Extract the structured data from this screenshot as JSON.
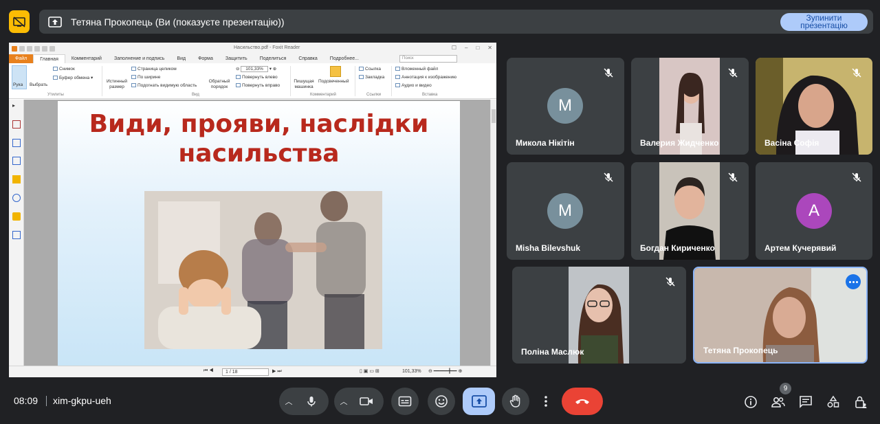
{
  "presentation_banner": {
    "title": "Тетяна Прокопець (Ви (показуєте презентацію))",
    "stop_button": "Зупинити презентацію"
  },
  "pdf_viewer": {
    "window_title": "Насильство.pdf - Foxit Reader",
    "tabs": [
      "Файл",
      "Главная",
      "Комментарий",
      "Заполнение и подпись",
      "Вид",
      "Форма",
      "Защитить",
      "Поделиться",
      "Справка",
      "Подробнее..."
    ],
    "search_placeholder": "Поиск",
    "ribbon": {
      "hand": "Рука",
      "select": "Выбрать",
      "snapshot": "Снимок",
      "clipboard": "Буфер обмена",
      "group_utilities": "Утилиты",
      "actual_size": "Истинный размер",
      "fit_page": "Страница целиком",
      "fit_width": "По ширине",
      "fit_visible": "Подогнать видимую область",
      "reverse_order": "Обратный порядок",
      "zoom": "101,33%",
      "rotate_left": "Повернуть влево",
      "rotate_right": "Повернуть вправо",
      "group_view": "Вид",
      "typewriter": "Пишущая машинка",
      "highlight": "Подсвеченный",
      "group_comment": "Комментарий",
      "link": "Ссылка",
      "bookmark": "Закладка",
      "group_links": "Ссылки",
      "attachment": "Вложенный файл",
      "image_annotation": "Аннотация к изображению",
      "audio_video": "Аудио и видео",
      "group_insert": "Вставка"
    },
    "slide_title": "Види, прояви, наслідки насильства",
    "page_indicator": "1 / 18",
    "status_zoom": "101,33%"
  },
  "participants": [
    {
      "name": "Микола Нікітін",
      "initial": "M",
      "avatar_color": "#78909c",
      "muted": true
    },
    {
      "name": "Валерия Жидченко",
      "muted": true
    },
    {
      "name": "Васіна Софія",
      "muted": true
    },
    {
      "name": "Misha Bilevshuk",
      "initial": "M",
      "avatar_color": "#78909c",
      "muted": true
    },
    {
      "name": "Богдан Кириченко",
      "muted": true
    },
    {
      "name": "Артем Кучерявий",
      "initial": "A",
      "avatar_color": "#ab47bc",
      "muted": true
    },
    {
      "name": "Поліна Маслюк",
      "muted": true
    },
    {
      "name": "Тетяна Прокопець",
      "muted": false
    }
  ],
  "meeting": {
    "time": "08:09",
    "code": "xim-gkpu-ueh",
    "participant_count": "9"
  },
  "colors": {
    "background": "#202124",
    "tile": "#3c4043",
    "present_active": "#aecbfa",
    "end_call": "#ea4335",
    "self_border": "#8ab4f8",
    "slide_title": "#b8291d"
  }
}
